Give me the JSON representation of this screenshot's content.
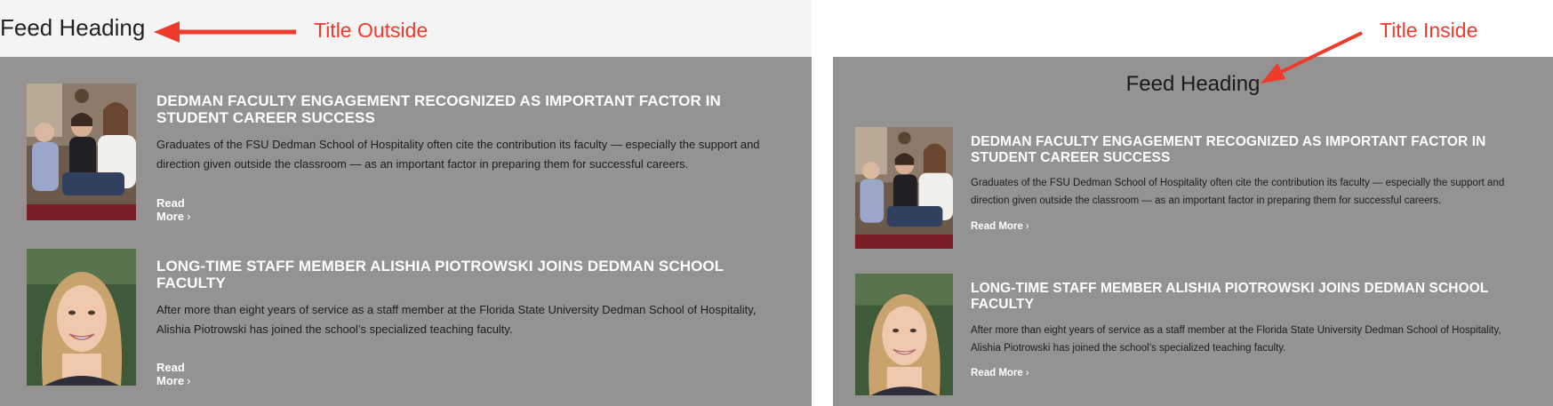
{
  "left_panel": {
    "heading": "Feed Heading",
    "annotation": "Title Outside"
  },
  "right_panel": {
    "heading": "Feed Heading",
    "annotation": "Title Inside"
  },
  "articles": [
    {
      "title": "DEDMAN FACULTY ENGAGEMENT RECOGNIZED AS IMPORTANT FACTOR IN STUDENT CAREER SUCCESS",
      "summary": "Graduates of the FSU Dedman School of Hospitality often cite the contribution its faculty — especially the support and direction given outside the classroom — as an important factor in preparing them for successful careers.",
      "read_more": "Read More",
      "chevron": "›",
      "image": "students-group-photo"
    },
    {
      "title": "LONG-TIME STAFF MEMBER ALISHIA PIOTROWSKI JOINS DEDMAN SCHOOL FACULTY",
      "summary": "After more than eight years of service as a staff member at the Florida State University Dedman School of Hospitality, Alishia Piotrowski has joined the school’s specialized teaching faculty.",
      "read_more": "Read More",
      "chevron": "›",
      "image": "woman-portrait-photo"
    }
  ],
  "colors": {
    "feed_background": "#949391",
    "annotation": "#ef3b2c",
    "title_text": "#ffffff",
    "heading_band": "#f4f4f4"
  }
}
